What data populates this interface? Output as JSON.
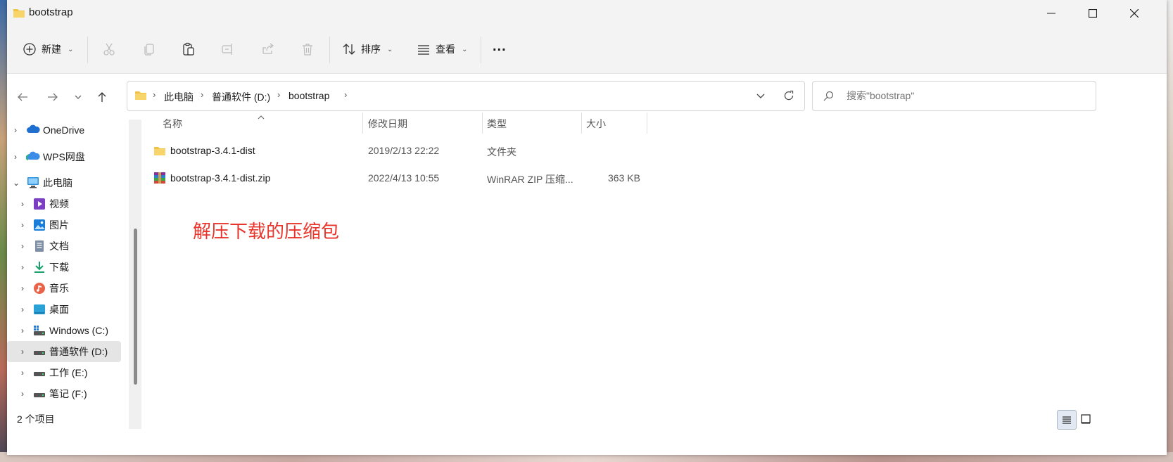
{
  "window": {
    "title": "bootstrap",
    "controls": [
      "minimize",
      "maximize",
      "close"
    ]
  },
  "toolbar": {
    "new_label": "新建",
    "sort_label": "排序",
    "view_label": "查看",
    "more_label": "..."
  },
  "address": {
    "crumbs": [
      "此电脑",
      "普通软件 (D:)",
      "bootstrap"
    ]
  },
  "search": {
    "placeholder": "搜索\"bootstrap\""
  },
  "sidebar": {
    "items": [
      {
        "label": "OneDrive",
        "icon": "onedrive-icon"
      },
      {
        "label": "WPS网盘",
        "icon": "wps-cloud-icon"
      },
      {
        "label": "此电脑",
        "icon": "computer-icon",
        "expanded": true
      },
      {
        "label": "视频",
        "icon": "video-icon"
      },
      {
        "label": "图片",
        "icon": "pictures-icon"
      },
      {
        "label": "文档",
        "icon": "documents-icon"
      },
      {
        "label": "下载",
        "icon": "download-icon"
      },
      {
        "label": "音乐",
        "icon": "music-icon"
      },
      {
        "label": "桌面",
        "icon": "desktop-icon"
      },
      {
        "label": "Windows (C:)",
        "icon": "drive-c-icon"
      },
      {
        "label": "普通软件 (D:)",
        "icon": "drive-icon",
        "selected": true
      },
      {
        "label": "工作 (E:)",
        "icon": "drive-icon"
      },
      {
        "label": "笔记 (F:)",
        "icon": "drive-icon"
      }
    ]
  },
  "columns": {
    "name": "名称",
    "modified": "修改日期",
    "type": "类型",
    "size": "大小"
  },
  "files": [
    {
      "name": "bootstrap-3.4.1-dist",
      "modified": "2019/2/13 22:22",
      "type": "文件夹",
      "size": "",
      "icon": "folder-icon"
    },
    {
      "name": "bootstrap-3.4.1-dist.zip",
      "modified": "2022/4/13 10:55",
      "type": "WinRAR ZIP 压缩...",
      "size": "363 KB",
      "icon": "winrar-archive-icon"
    }
  ],
  "annotation": "解压下载的压缩包",
  "status": {
    "item_count": "2 个项目"
  },
  "colors": {
    "accent_folder": "#f2c244",
    "annotation": "#e8342a",
    "selected_bg": "#e5e5e5"
  }
}
